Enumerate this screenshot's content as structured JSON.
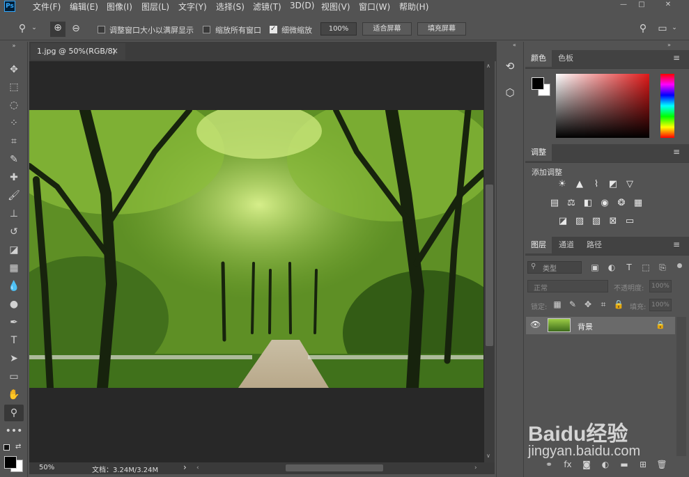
{
  "app": {
    "logo_text": "Ps"
  },
  "menu": [
    "文件(F)",
    "编辑(E)",
    "图像(I)",
    "图层(L)",
    "文字(Y)",
    "选择(S)",
    "滤镜(T)",
    "3D(D)",
    "视图(V)",
    "窗口(W)",
    "帮助(H)"
  ],
  "window_controls": {
    "minimize": "—",
    "maximize": "□",
    "close": "✕"
  },
  "options": {
    "resize_windows_label": "调整窗口大小以满屏显示",
    "zoom_all_label": "缩放所有窗口",
    "scrubby_zoom_label": "细微缩放",
    "scrubby_zoom_checked": true,
    "zoom_value": "100%",
    "fit_screen_label": "适合屏幕",
    "fill_screen_label": "填充屏幕"
  },
  "document": {
    "tab_title": "1.jpg @ 50%(RGB/8)",
    "tab_close": "×",
    "zoom_status": "50%",
    "doc_info": "文档：3.24M/3.24M",
    "status_arrow": "›"
  },
  "panels": {
    "color": {
      "tabs": [
        "颜色",
        "色板"
      ]
    },
    "adjustments": {
      "tab": "调整",
      "add_label": "添加调整"
    },
    "layers": {
      "tabs": [
        "图层",
        "通道",
        "路径"
      ],
      "filter_kind": "类型",
      "blend_mode": "正常",
      "opacity_label": "不透明度:",
      "opacity_value": "100%",
      "lock_label": "锁定:",
      "fill_label": "填充:",
      "fill_value": "100%",
      "layer_name": "背景"
    }
  },
  "watermark": {
    "brand": "Baidu经验",
    "url": "jingyan.baidu.com"
  }
}
